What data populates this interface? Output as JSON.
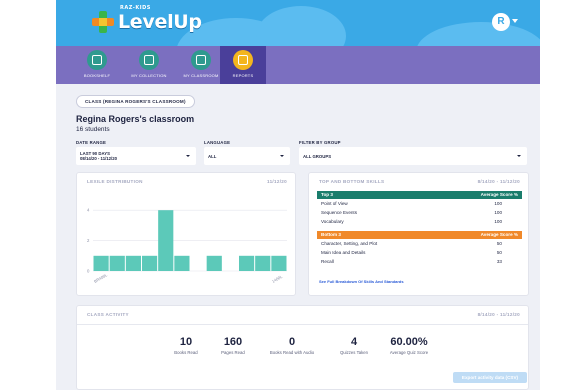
{
  "header": {
    "logo_text": "LevelUp",
    "logo_super": "RAZ-KIDS",
    "avatar_initial": "R",
    "colors": {
      "sky": "#3aa9e6",
      "nav": "#7b6fc0",
      "nav_active": "#4a3f9a"
    }
  },
  "nav": {
    "items": [
      {
        "label": "BOOKSHELF",
        "icon": "bookshelf-icon"
      },
      {
        "label": "MY COLLECTION",
        "icon": "collection-icon"
      },
      {
        "label": "MY CLASSROOM",
        "icon": "classroom-icon"
      },
      {
        "label": "REPORTS",
        "icon": "reports-icon",
        "active": true
      }
    ]
  },
  "class_pill": "CLASS (REGINA ROGERS'S CLASSROOM)",
  "class_title": "Regina Rogers's classroom",
  "students": "16 students",
  "filters": {
    "date_range": {
      "label": "DATE RANGE",
      "value_line1": "LAST 90 DAYS",
      "value_line2": "08/14/20 - 11/12/20"
    },
    "language": {
      "label": "LANGUAGE",
      "value": "ALL"
    },
    "group": {
      "label": "FILTER BY GROUP",
      "value": "ALL GROUPS"
    }
  },
  "lexile": {
    "title": "LEXILE DISTRIBUTION",
    "date": "11/12/20",
    "y_labels": [
      "4",
      "2",
      "0"
    ],
    "x_start": "BR400L",
    "x_end": "1400L"
  },
  "chart_data": {
    "type": "bar",
    "title": "LEXILE DISTRIBUTION",
    "x_start_label": "BR400L",
    "x_end_label": "1400L",
    "ylim": [
      0,
      5
    ],
    "values": [
      1,
      1,
      1,
      1,
      4,
      1,
      0,
      1,
      0,
      1,
      1,
      1
    ],
    "color": "#5cc9b9"
  },
  "skills": {
    "title": "TOP AND BOTTOM SKILLS",
    "date": "8/14/20 - 11/12/20",
    "top_header": "Top 3",
    "bottom_header": "Bottom 3",
    "score_header": "Average Score %",
    "top": [
      {
        "name": "Point of View",
        "score": "100"
      },
      {
        "name": "Sequence Events",
        "score": "100"
      },
      {
        "name": "Vocabulary",
        "score": "100"
      }
    ],
    "bottom": [
      {
        "name": "Character, Setting, and Plot",
        "score": "50"
      },
      {
        "name": "Main Idea and Details",
        "score": "50"
      },
      {
        "name": "Recall",
        "score": "33"
      }
    ],
    "breakdown_link": "See Full Breakdown Of Skills And Standards"
  },
  "activity": {
    "title": "CLASS ACTIVITY",
    "date": "8/14/20 - 11/12/20",
    "stats": [
      {
        "value": "10",
        "label": "Books Read"
      },
      {
        "value": "160",
        "label": "Pages Read"
      },
      {
        "value": "0",
        "label": "Books Read with Audio"
      },
      {
        "value": "4",
        "label": "Quizzes Taken"
      },
      {
        "value": "60.00%",
        "label": "Average Quiz Score"
      }
    ],
    "export_label": "Export activity data (CSV)"
  }
}
